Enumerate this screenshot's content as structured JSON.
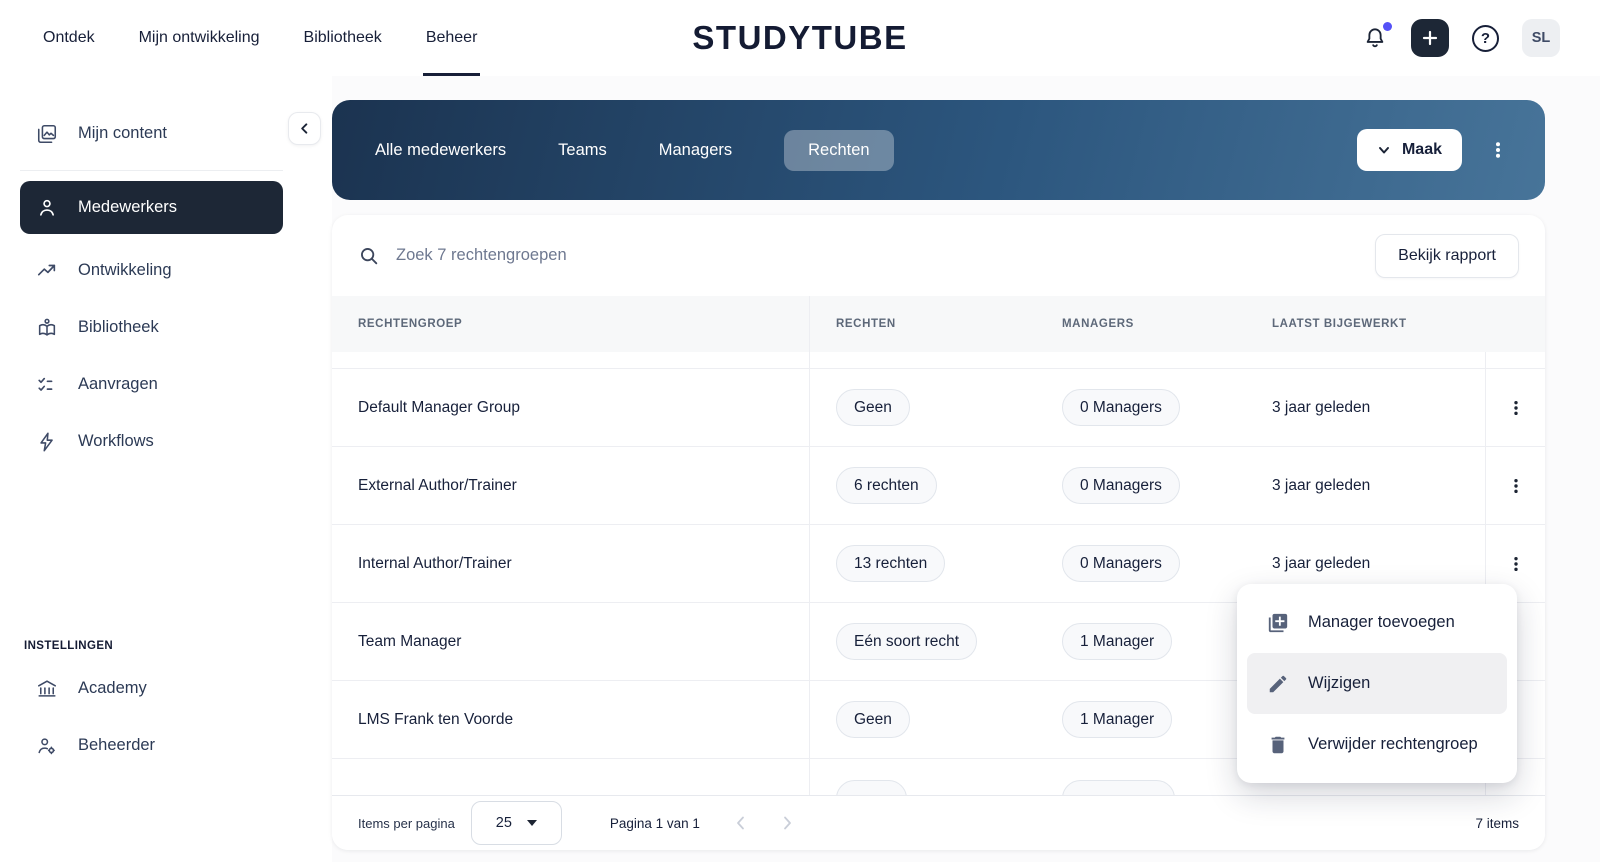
{
  "topbar": {
    "nav": [
      {
        "label": "Ontdek"
      },
      {
        "label": "Mijn ontwikkeling"
      },
      {
        "label": "Bibliotheek"
      },
      {
        "label": "Beheer"
      }
    ],
    "logo_text": "STUDYTUBE",
    "avatar_initials": "SL"
  },
  "sidebar": {
    "items": [
      {
        "label": "Mijn content"
      },
      {
        "label": "Medewerkers"
      },
      {
        "label": "Ontwikkeling"
      },
      {
        "label": "Bibliotheek"
      },
      {
        "label": "Aanvragen"
      },
      {
        "label": "Workflows"
      }
    ],
    "settings_label": "INSTELLINGEN",
    "settings_items": [
      {
        "label": "Academy"
      },
      {
        "label": "Beheerder"
      }
    ]
  },
  "header": {
    "tabs": [
      {
        "label": "Alle medewerkers"
      },
      {
        "label": "Teams"
      },
      {
        "label": "Managers"
      },
      {
        "label": "Rechten"
      }
    ],
    "create_label": "Maak"
  },
  "toolbar": {
    "search_placeholder": "Zoek 7 rechtengroepen",
    "report_button": "Bekijk rapport"
  },
  "table": {
    "columns": [
      "RECHTENGROEP",
      "RECHTEN",
      "MANAGERS",
      "LAATST BIJGEWERKT"
    ],
    "rows": [
      {
        "name": "Default Manager Group",
        "rechten": "Geen",
        "managers": "0 Managers",
        "updated": "3 jaar geleden"
      },
      {
        "name": "External Author/Trainer",
        "rechten": "6 rechten",
        "managers": "0 Managers",
        "updated": "3 jaar geleden"
      },
      {
        "name": "Internal Author/Trainer",
        "rechten": "13 rechten",
        "managers": "0 Managers",
        "updated": "3 jaar geleden"
      },
      {
        "name": "Team Manager",
        "rechten": "Eén soort recht",
        "managers": "1 Manager",
        "updated": ""
      },
      {
        "name": "LMS Frank ten Voorde",
        "rechten": "Geen",
        "managers": "1 Manager",
        "updated": ""
      },
      {
        "name": "",
        "rechten": "",
        "managers": "",
        "updated": ""
      }
    ]
  },
  "context_menu": {
    "items": [
      {
        "label": "Manager toevoegen"
      },
      {
        "label": "Wijzigen"
      },
      {
        "label": "Verwijder rechtengroep"
      }
    ]
  },
  "pagination": {
    "per_page_label": "Items per pagina",
    "per_page_value": "25",
    "page_label": "Pagina 1 van 1",
    "total_label": "7 items"
  },
  "colors": {
    "accent_navy": "#1d2736",
    "header_gradient_start": "#1b3350",
    "header_gradient_end": "#477499",
    "notification_dot": "#5551f7",
    "active_tab_pill": "rgba(255,255,255,0.32)"
  }
}
